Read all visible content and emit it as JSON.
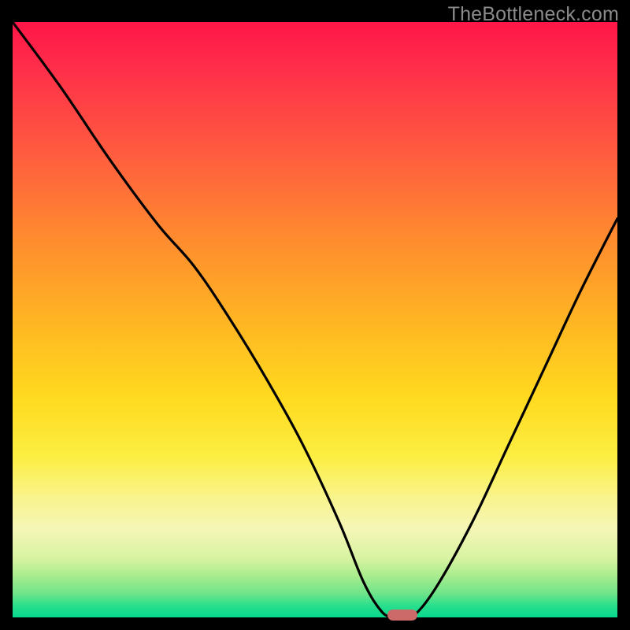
{
  "watermark": "TheBottleneck.com",
  "colors": {
    "frame": "#000000",
    "gradient_top": "#ff1648",
    "gradient_bottom": "#07d98e",
    "curve": "#000000",
    "marker": "#cc6a6a",
    "watermark": "#8b8b8b"
  },
  "chart_data": {
    "type": "line",
    "title": "",
    "xlabel": "",
    "ylabel": "",
    "xlim": [
      0,
      100
    ],
    "ylim": [
      0,
      100
    ],
    "series": [
      {
        "name": "bottleneck-curve",
        "x": [
          0,
          8,
          16,
          24,
          30,
          36,
          42,
          48,
          54,
          58,
          61,
          63,
          64,
          66,
          70,
          76,
          82,
          88,
          94,
          100
        ],
        "y": [
          100,
          89,
          77,
          66,
          59,
          50,
          40,
          29,
          16,
          6,
          1,
          0,
          0,
          0,
          5,
          16,
          29,
          42,
          55,
          67
        ]
      }
    ],
    "marker": {
      "x": 64.5,
      "y": 0.4
    },
    "notes": "y is bottleneck percentage (0 = no bottleneck / green floor, 100 = top / red). Values estimated from pixel positions on an unlabeled gradient plot."
  }
}
